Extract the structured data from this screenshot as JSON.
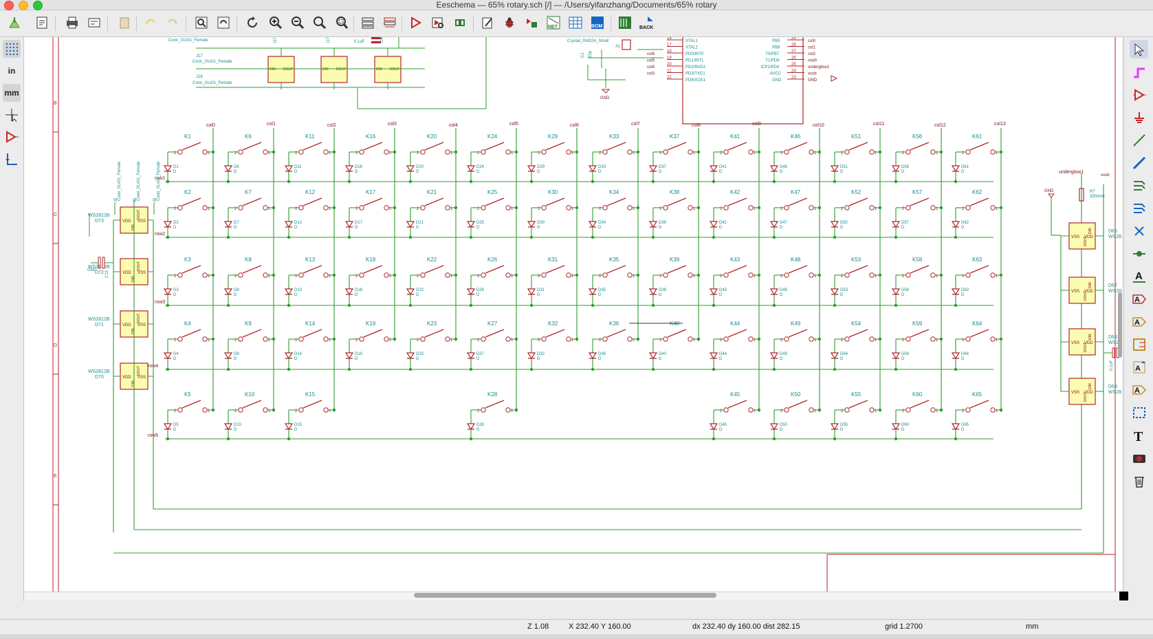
{
  "window": {
    "title": "Eeschema — 65% rotary.sch [/] — /Users/yifanzhang/Documents/65% rotary"
  },
  "toolbar": {
    "items": [
      "new-sheet",
      "page-settings",
      "print",
      "plot",
      "paste",
      "undo",
      "redo",
      "find",
      "find-replace",
      "redraw",
      "zoom-in",
      "zoom-out",
      "zoom-fit",
      "zoom-selection",
      "hierarchy-navigator",
      "leave-sheet",
      "symbol-editor",
      "symbol-library-browser",
      "footprint-editor",
      "annotate",
      "erc",
      "assign-footprints",
      "generate-netlist",
      "bom-table",
      "bom",
      "pcbnew",
      "back-annotate"
    ],
    "net_label": "NET",
    "bom_label": "BOM",
    "back_label": "BACK"
  },
  "left_toolbar": {
    "in_label": "in",
    "mm_label": "mm"
  },
  "status": {
    "zoom": "Z 1.08",
    "cursor": "X 232.40  Y 160.00",
    "delta": "dx 232.40  dy 160.00  dist 282.15",
    "grid": "grid 1.2700",
    "units": "mm"
  },
  "schematic": {
    "col_labels": [
      "col0",
      "col1",
      "col2",
      "col3",
      "col4",
      "col5",
      "col6",
      "col7",
      "col8",
      "col9",
      "col10",
      "col11",
      "col12",
      "col13"
    ],
    "row_labels": [
      "row1",
      "row2",
      "row3",
      "row4",
      "row5"
    ],
    "underglow_label": "underglow1",
    "vusb": "vusb",
    "gnd": "GND",
    "keys": [
      [
        "K1",
        "K6",
        "K11",
        "K16",
        "K20",
        "K24",
        "K29",
        "K33",
        "K37",
        "K41",
        "K46",
        "K51",
        "K56",
        "K61"
      ],
      [
        "K2",
        "K7",
        "K12",
        "K17",
        "K21",
        "K25",
        "K30",
        "K34",
        "K38",
        "K42",
        "K47",
        "K52",
        "K57",
        "K62"
      ],
      [
        "K3",
        "K8",
        "K13",
        "K18",
        "K22",
        "K26",
        "K31",
        "K35",
        "K39",
        "K43",
        "K48",
        "K53",
        "K58",
        "K63"
      ],
      [
        "K4",
        "K9",
        "K14",
        "K19",
        "K23",
        "K27",
        "K32",
        "K36",
        "K40",
        "K44",
        "K49",
        "K54",
        "K59",
        "K64"
      ],
      [
        "K5",
        "K10",
        "K15",
        "",
        "",
        "K28",
        "",
        "",
        "",
        "K45",
        "K50",
        "K55",
        "K60",
        "K65"
      ]
    ],
    "diodes": [
      [
        "D1",
        "D6",
        "D11",
        "D16",
        "D20",
        "D24",
        "D29",
        "D33",
        "D37",
        "D41",
        "D46",
        "D51",
        "D56",
        "D61"
      ],
      [
        "D2",
        "D7",
        "D12",
        "D17",
        "D21",
        "D25",
        "D30",
        "D34",
        "D38",
        "D42",
        "D47",
        "D52",
        "D57",
        "D62"
      ],
      [
        "D3",
        "D8",
        "D13",
        "D18",
        "D22",
        "D26",
        "D31",
        "D35",
        "D39",
        "D43",
        "D48",
        "D53",
        "D58",
        "D63"
      ],
      [
        "D4",
        "D9",
        "D14",
        "D19",
        "D23",
        "D27",
        "D32",
        "D36",
        "D40",
        "D44",
        "D49",
        "D54",
        "D59",
        "D64"
      ],
      [
        "D5",
        "D10",
        "D15",
        "",
        "",
        "D28",
        "",
        "",
        "",
        "D45",
        "D50",
        "D55",
        "D60",
        "D65"
      ]
    ],
    "left_leds": [
      "D73",
      "D72",
      "D71",
      "D70"
    ],
    "right_leds": [
      "D66",
      "D67",
      "D68",
      "D69"
    ],
    "led_part": "WS2812B",
    "led_pins": {
      "vdd": "VDD",
      "vss": "VSS",
      "din": "DIN",
      "dout": "DOUT"
    },
    "connectors": [
      "J5",
      "J6",
      "J9"
    ],
    "connector_part": "Conn_01x01_Female",
    "top_connectors": [
      "J17",
      "J18"
    ],
    "top_leds": [
      "D76",
      "D78",
      "D80"
    ],
    "top_cap": {
      "ref": "C15",
      "val": "0.1uF"
    },
    "left_cap": {
      "ref": "C12",
      "val": "GND"
    },
    "right_cap": {
      "ref": "C16",
      "val": "0.1uF"
    },
    "resistor": {
      "ref": "R7",
      "val": "330ohm"
    },
    "crystal": {
      "label": "Crystal_GND24_Small",
      "ref": "X1",
      "cap_ref": "C1",
      "cap_val": "22p"
    },
    "mcu_left_pins": [
      {
        "num": "16",
        "name": "XTAL1"
      },
      {
        "num": "17",
        "name": "XTAL2"
      },
      {
        "num": "18",
        "name": "PD0/INT0"
      },
      {
        "num": "19",
        "name": "PD1/INT1"
      },
      {
        "num": "20",
        "name": "PD2/RXD1"
      },
      {
        "num": "21",
        "name": "PD3/TXD1"
      },
      {
        "num": "22",
        "name": "PD5/XCK1"
      }
    ],
    "mcu_left_nets": [
      "",
      "",
      "col6",
      "col5",
      "col4",
      "col3",
      ""
    ],
    "mcu_right_pins": [
      {
        "num": "29",
        "name": "PB5",
        "net": "col0"
      },
      {
        "num": "28",
        "name": "PB6",
        "net": "col1"
      },
      {
        "num": "27",
        "name": "T0/PB7",
        "net": "col2"
      },
      {
        "num": "26",
        "name": "T1/PD6",
        "net": "row0"
      },
      {
        "num": "25",
        "name": "ICP1/PD4",
        "net": "underglow1"
      },
      {
        "num": "24",
        "name": "AVCC",
        "net": "vusb"
      },
      {
        "num": "23",
        "name": "GND",
        "net": "GND"
      }
    ],
    "border_letters": [
      "B",
      "C",
      "D",
      "E"
    ]
  }
}
